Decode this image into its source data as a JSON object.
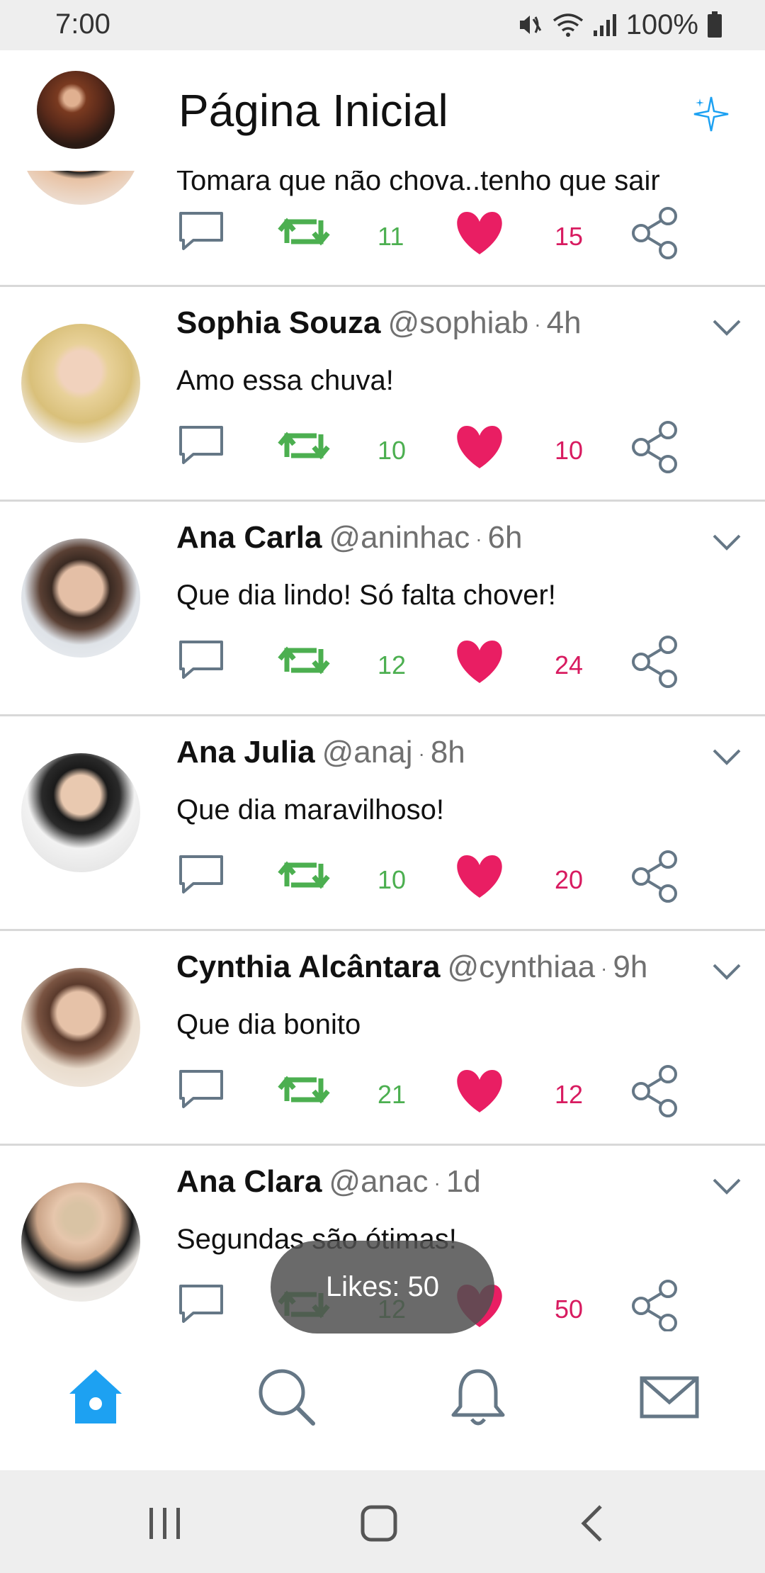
{
  "status_bar": {
    "time": "7:00",
    "battery_percent": "100%",
    "icons": [
      "mute-icon",
      "wifi-icon",
      "signal-icon",
      "battery-icon"
    ]
  },
  "header": {
    "title": "Página Inicial",
    "icon_right": "sparkle-icon",
    "avatar": "profile-avatar"
  },
  "colors": {
    "retweet": "#4caf50",
    "like": "#d81b60",
    "icon_gray": "#657786",
    "nav_active": "#1da1f2"
  },
  "tweets": [
    {
      "name": "",
      "handle": "",
      "time": "",
      "text": "Tomara que não chova..tenho que sair",
      "retweets": "11",
      "likes": "15"
    },
    {
      "name": "Sophia Souza",
      "handle": "@sophiab",
      "time": "4h",
      "text": "Amo essa chuva!",
      "retweets": "10",
      "likes": "10"
    },
    {
      "name": "Ana Carla",
      "handle": "@aninhac",
      "time": "6h",
      "text": "Que dia lindo! Só falta chover!",
      "retweets": "12",
      "likes": "24"
    },
    {
      "name": "Ana Julia",
      "handle": "@anaj",
      "time": "8h",
      "text": "Que dia maravilhoso!",
      "retweets": "10",
      "likes": "20"
    },
    {
      "name": "Cynthia Alcântara",
      "handle": "@cynthiaa",
      "time": "9h",
      "text": "Que dia bonito",
      "retweets": "21",
      "likes": "12"
    },
    {
      "name": "Ana Clara",
      "handle": "@anac",
      "time": "1d",
      "text": "Segundas são ótimas!",
      "retweets": "12",
      "likes": "50"
    }
  ],
  "dot_separator": "·",
  "toast": {
    "text": "Likes: 50"
  },
  "bottom_nav": {
    "items": [
      "home-icon",
      "search-icon",
      "bell-icon",
      "mail-icon"
    ],
    "active": "home-icon"
  },
  "system_nav": {
    "items": [
      "recents-icon",
      "home-button-icon",
      "back-icon"
    ]
  }
}
